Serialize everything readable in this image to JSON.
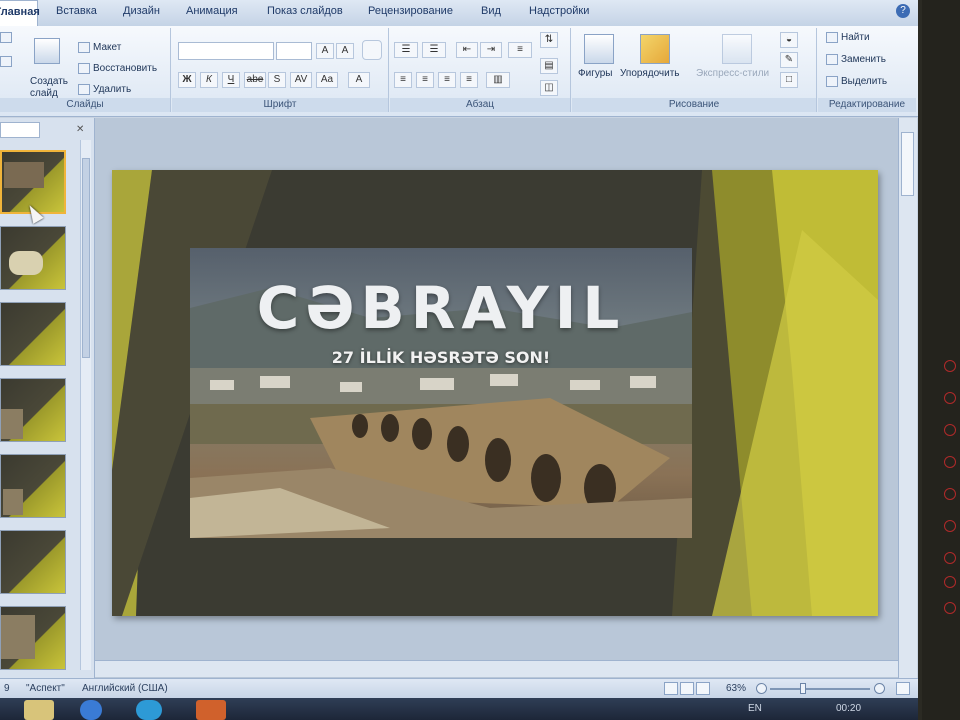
{
  "ribbon": {
    "tabs": [
      "Главная",
      "Вставка",
      "Дизайн",
      "Анимация",
      "Показ слайдов",
      "Рецензирование",
      "Вид",
      "Надстройки"
    ],
    "active_tab": "Главная",
    "slides_group": {
      "label": "Слайды",
      "create_slide": "Создать слайд",
      "layout": "Макет",
      "reset": "Восстановить",
      "delete": "Удалить"
    },
    "font_group": {
      "label": "Шрифт",
      "bold": "Ж",
      "italic": "К",
      "underline": "Ч",
      "strike": "abe",
      "shadow": "S",
      "spacing": "AV",
      "case": "Aa",
      "grow": "A",
      "shrink": "A"
    },
    "paragraph_group": {
      "label": "Абзац"
    },
    "drawing_group": {
      "label": "Рисование",
      "shapes": "Фигуры",
      "arrange": "Упорядочить",
      "quick_styles": "Экспресс-стили"
    },
    "editing_group": {
      "label": "Редактирование",
      "find": "Найти",
      "replace": "Заменить",
      "select": "Выделить"
    }
  },
  "slide": {
    "title": "CƏBRAYIL",
    "subtitle": "27 İLLİK HƏSRƏTƏ SON!"
  },
  "status": {
    "slide_number": "9",
    "theme": "\"Аспект\"",
    "language": "Английский (США)",
    "zoom": "63%"
  },
  "taskbar": {
    "lang": "EN",
    "time": "00:20"
  },
  "colors": {
    "ribbon_bg": "#dbe6f3",
    "slide_dark": "#3b3b32",
    "slide_accent": "#c9c43a",
    "selection": "#f0b43a"
  }
}
